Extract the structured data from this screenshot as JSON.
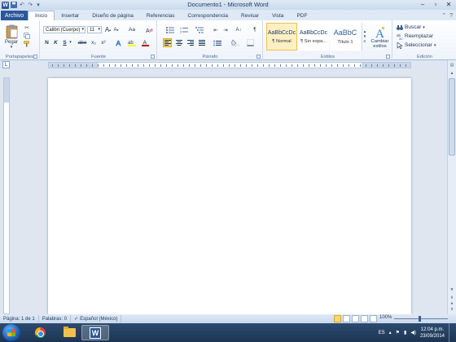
{
  "window": {
    "title": "Documento1 - Microsoft Word",
    "app_icon": "W",
    "quick_access": [
      "save-icon",
      "undo-icon",
      "redo-icon",
      "customize-icon"
    ],
    "controls": [
      "minimize",
      "restore",
      "close"
    ]
  },
  "tabs": {
    "file": "Archivo",
    "items": [
      "Inicio",
      "Insertar",
      "Diseño de página",
      "Referencias",
      "Correspondencia",
      "Revisar",
      "Vista",
      "PDF"
    ],
    "active": "Inicio"
  },
  "ribbon": {
    "clipboard": {
      "label": "Portapapeles",
      "paste": "Pegar"
    },
    "font": {
      "label": "Fuente",
      "font_name": "Calibri (Cuerpo)",
      "font_size": "11",
      "bold": "N",
      "italic": "K",
      "underline": "S",
      "strike": "abe",
      "subscript": "x₂",
      "superscript": "x²",
      "grow": "A",
      "shrink": "A",
      "case": "Aa",
      "highlight_color": "#ffff00",
      "font_color": "#c00000"
    },
    "paragraph": {
      "label": "Párrafo",
      "show_marks": "¶"
    },
    "styles": {
      "label": "Estilos",
      "items": [
        {
          "preview": "AaBbCcDc",
          "name": "¶ Normal",
          "selected": true
        },
        {
          "preview": "AaBbCcDc",
          "name": "¶ Sin espa...",
          "selected": false
        },
        {
          "preview": "AaBbC",
          "name": "Título 1",
          "selected": false
        }
      ],
      "change_styles_1": "Cambiar",
      "change_styles_2": "estilos"
    },
    "editing": {
      "label": "Edición",
      "find": "Buscar",
      "replace": "Reemplazar",
      "select": "Seleccionar"
    }
  },
  "statusbar": {
    "page": "Página: 1 de 1",
    "words": "Palabras: 0",
    "language": "Español (México)",
    "zoom": "100%"
  },
  "taskbar": {
    "apps": [
      {
        "name": "Google Chrome",
        "icon": "chrome-icon",
        "active": false
      },
      {
        "name": "Explorador",
        "icon": "folder-icon",
        "active": false
      },
      {
        "name": "Microsoft Word",
        "icon": "word-icon",
        "active": true
      }
    ],
    "input_lang": "ES",
    "time": "12:04 p.m.",
    "date": "23/09/2014"
  },
  "colors": {
    "accent": "#2b579a",
    "ribbon_bg": "#f5f8fc",
    "selected_style": "#fdf0c4"
  }
}
